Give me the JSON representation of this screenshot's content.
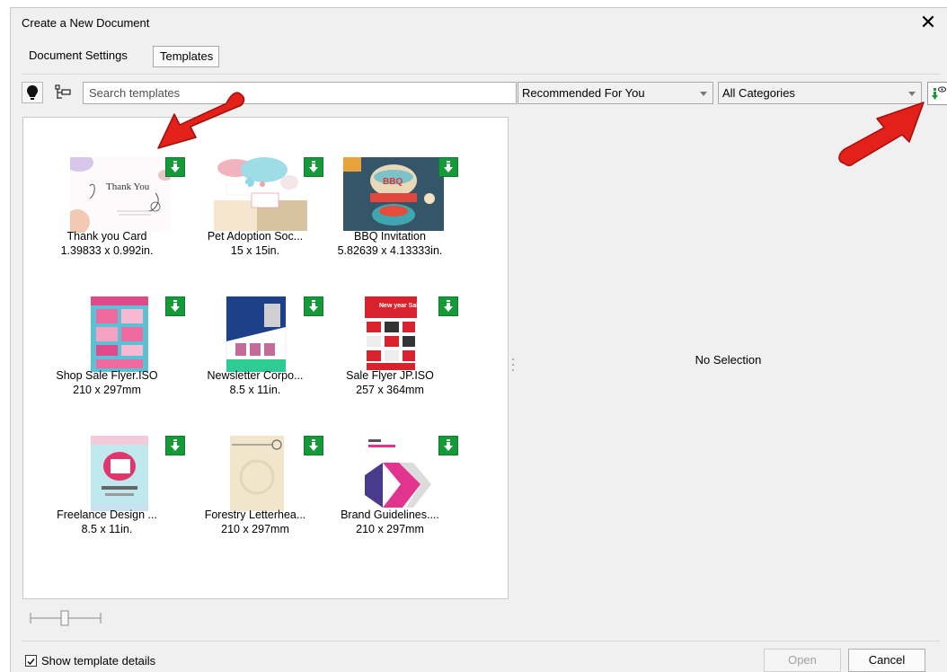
{
  "window": {
    "title": "Create a New Document",
    "close_icon": "close-icon"
  },
  "tabs": [
    {
      "label": "Document Settings",
      "active": false
    },
    {
      "label": "Templates",
      "active": true
    }
  ],
  "toolbar": {
    "bulb_icon": "lightbulb-icon",
    "tree_icon": "folder-tree-icon",
    "search": {
      "value": "",
      "placeholder": "Search templates"
    },
    "filter_recommend": "Recommended For You",
    "filter_category": "All Categories",
    "download_icon": "download-view-icon"
  },
  "templates": [
    {
      "name": "Thank you Card",
      "size": "1.39833 x 0.992in."
    },
    {
      "name": "Pet Adoption Soc...",
      "size": "15 x 15in."
    },
    {
      "name": "BBQ Invitation",
      "size": "5.82639 x 4.13333in."
    },
    {
      "name": "Shop Sale Flyer.ISO",
      "size": "210 x 297mm"
    },
    {
      "name": "Newsletter Corpo...",
      "size": "8.5 x 11in."
    },
    {
      "name": "Sale Flyer JP.ISO",
      "size": "257 x 364mm"
    },
    {
      "name": "Freelance Design ...",
      "size": "8.5 x 11in."
    },
    {
      "name": "Forestry Letterhea...",
      "size": "210 x 297mm"
    },
    {
      "name": "Brand Guidelines....",
      "size": "210 x 297mm"
    }
  ],
  "thumb_text": {
    "thank_you": "Thank You",
    "bbq": "BBQ",
    "new_year": "New year Sale!"
  },
  "preview": {
    "empty_text": "No Selection"
  },
  "footer": {
    "show_details_label": "Show template details",
    "show_details_checked": true,
    "open_label": "Open",
    "cancel_label": "Cancel"
  },
  "colors": {
    "download_badge": "#159a3a",
    "annotation_arrow": "#e3201a"
  }
}
